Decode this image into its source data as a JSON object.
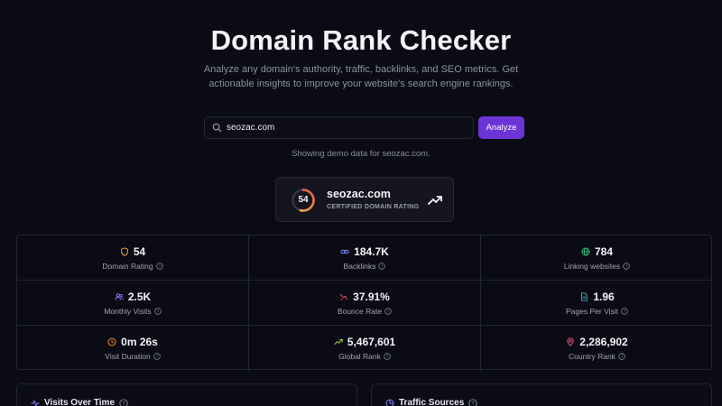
{
  "header": {
    "title": "Domain Rank Checker",
    "subtitle": "Analyze any domain's authority, traffic, backlinks, and SEO metrics. Get actionable insights to improve your website's search engine rankings."
  },
  "search": {
    "value": "seozac.com",
    "button_label": "Analyze",
    "demo_note": "Showing demo data for seozac.com."
  },
  "rating_card": {
    "score": "54",
    "score_fraction": 0.54,
    "domain": "seozac.com",
    "label": "CERTIFIED DOMAIN RATING"
  },
  "stats": [
    {
      "value": "54",
      "label": "Domain Rating",
      "icon": "shield-icon",
      "color": "#f0a33a"
    },
    {
      "value": "184.7K",
      "label": "Backlinks",
      "icon": "link-icon",
      "color": "#7b8cf6"
    },
    {
      "value": "784",
      "label": "Linking websites",
      "icon": "globe-icon",
      "color": "#36c47a"
    },
    {
      "value": "2.5K",
      "label": "Monthly Visits",
      "icon": "users-icon",
      "color": "#8b7cf6"
    },
    {
      "value": "37.91%",
      "label": "Bounce Rate",
      "icon": "bounce-icon",
      "color": "#ef5a6a"
    },
    {
      "value": "1.96",
      "label": "Pages Per Visit",
      "icon": "file-icon",
      "color": "#3fb5c8"
    },
    {
      "value": "0m 26s",
      "label": "Visit Duration",
      "icon": "clock-icon",
      "color": "#f08a2a"
    },
    {
      "value": "5,467,601",
      "label": "Global Rank",
      "icon": "trending-up-icon",
      "color": "#a3c93a"
    },
    {
      "value": "2,286,902",
      "label": "Country Rank",
      "icon": "map-pin-icon",
      "color": "#ef5a8a"
    }
  ],
  "panels": {
    "left_title": "Visits Over Time",
    "right_title": "Traffic Sources"
  }
}
